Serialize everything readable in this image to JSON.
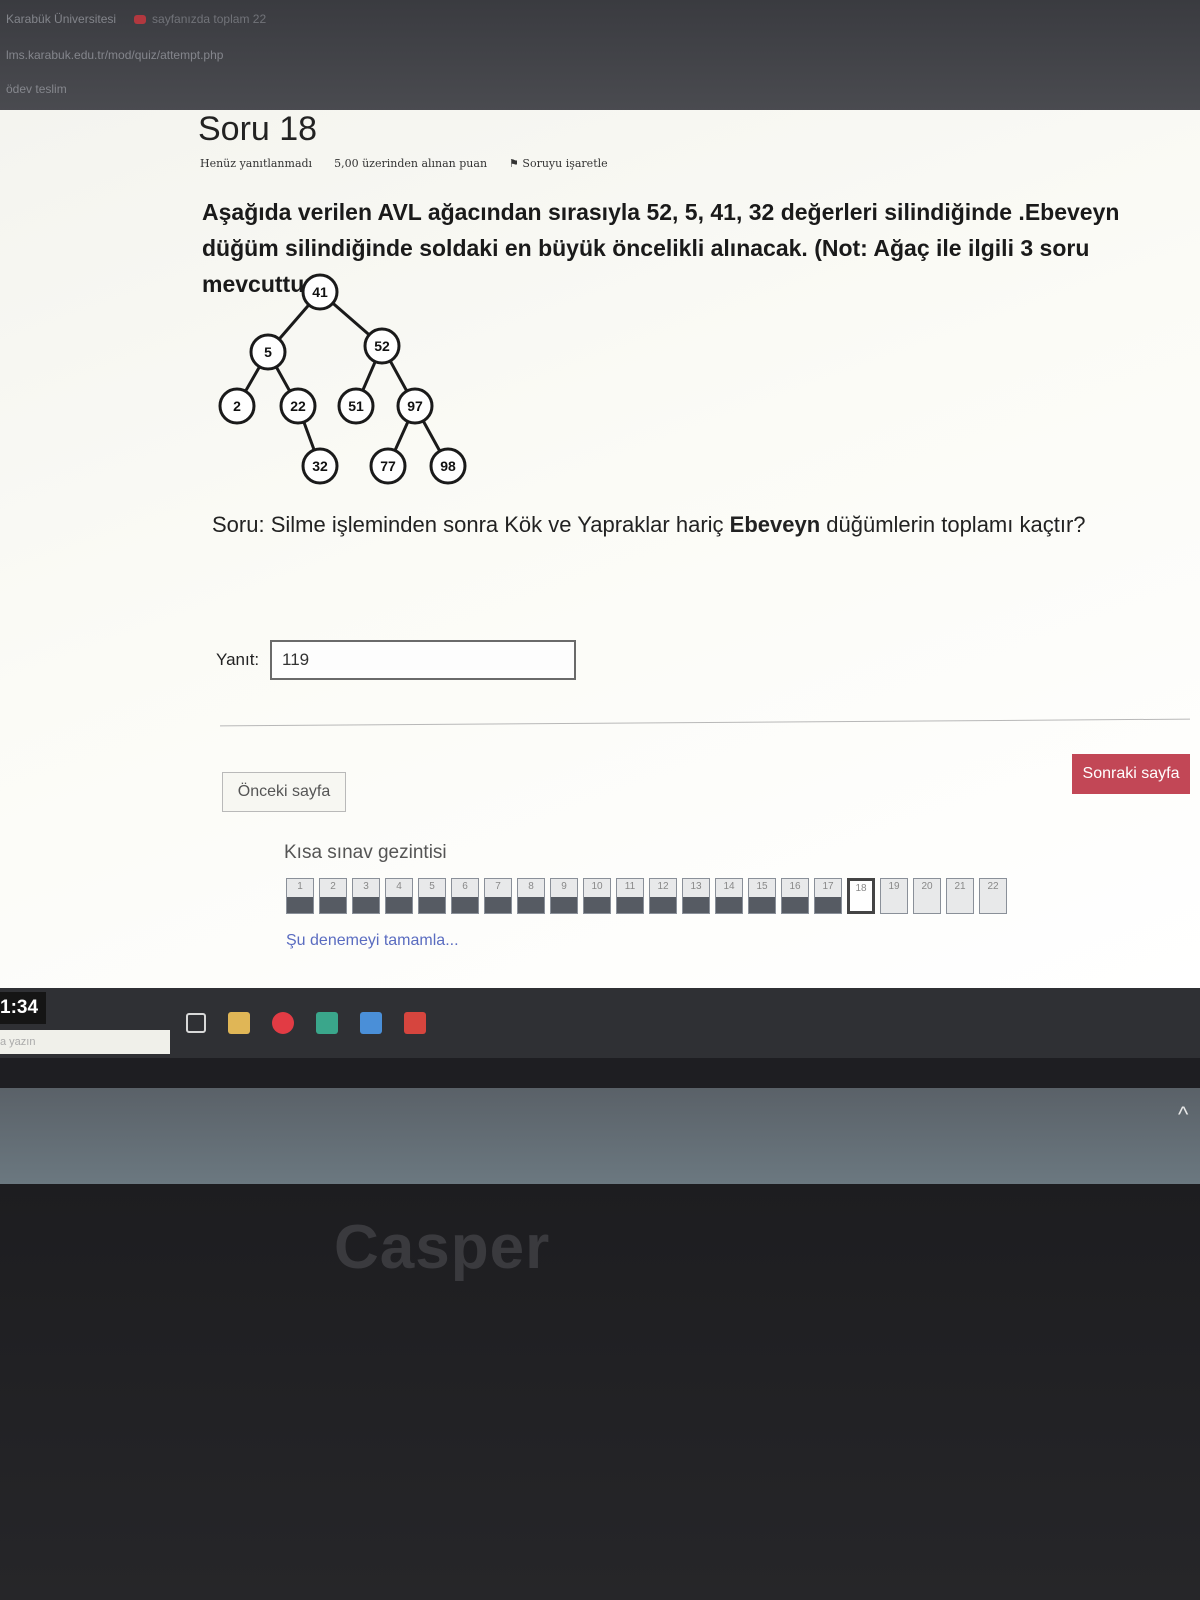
{
  "browser": {
    "tab_1": "Karabük Üniversitesi",
    "tab_2": "sayfanızda toplam 22",
    "address": "lms.karabuk.edu.tr/mod/quiz/attempt.php",
    "bookmark": "ödev teslim"
  },
  "question": {
    "title": "Soru 18",
    "status": "Henüz yanıtlanmadı",
    "points": "5,00 üzerinden alınan puan",
    "flag": "Soruyu işaretle",
    "text_part1": "Aşağıda verilen AVL ağacından sırasıyla ",
    "text_values": "52, 5, 41, 32",
    "text_part2": " değerleri silindiğinde .Ebeveyn düğüm silindiğinde soldaki en büyük öncelikli alınacak. (Not: Ağaç ile ilgili 3 soru mevcuttur).",
    "sub_part1": "Soru: Silme işleminden sonra Kök ve Yapraklar hariç ",
    "sub_bold": "Ebeveyn",
    "sub_part2": " düğümlerin toplamı kaçtır?"
  },
  "tree": {
    "nodes": [
      {
        "id": "n41",
        "label": "41"
      },
      {
        "id": "n5",
        "label": "5"
      },
      {
        "id": "n52",
        "label": "52"
      },
      {
        "id": "n2",
        "label": "2"
      },
      {
        "id": "n22",
        "label": "22"
      },
      {
        "id": "n51",
        "label": "51"
      },
      {
        "id": "n97",
        "label": "97"
      },
      {
        "id": "n32",
        "label": "32"
      },
      {
        "id": "n77",
        "label": "77"
      },
      {
        "id": "n98",
        "label": "98"
      }
    ]
  },
  "answer": {
    "label": "Yanıt:",
    "value": "119"
  },
  "buttons": {
    "prev": "Önceki sayfa",
    "next": "Sonraki sayfa"
  },
  "quiz_nav": {
    "title": "Kısa sınav gezintisi",
    "items": [
      "1",
      "2",
      "3",
      "4",
      "5",
      "6",
      "7",
      "8",
      "9",
      "10",
      "11",
      "12",
      "13",
      "14",
      "15",
      "16",
      "17",
      "18",
      "19",
      "20",
      "21",
      "22"
    ],
    "current": "18",
    "finish": "Şu denemeyi tamamla..."
  },
  "taskbar": {
    "clock": "1:34",
    "search_hint": "a yazın"
  },
  "laptop": {
    "brand": "Casper"
  },
  "colors": {
    "next_button": "#c24756",
    "nav_answered": "#565b63",
    "finish_link": "#5a6cc0"
  }
}
